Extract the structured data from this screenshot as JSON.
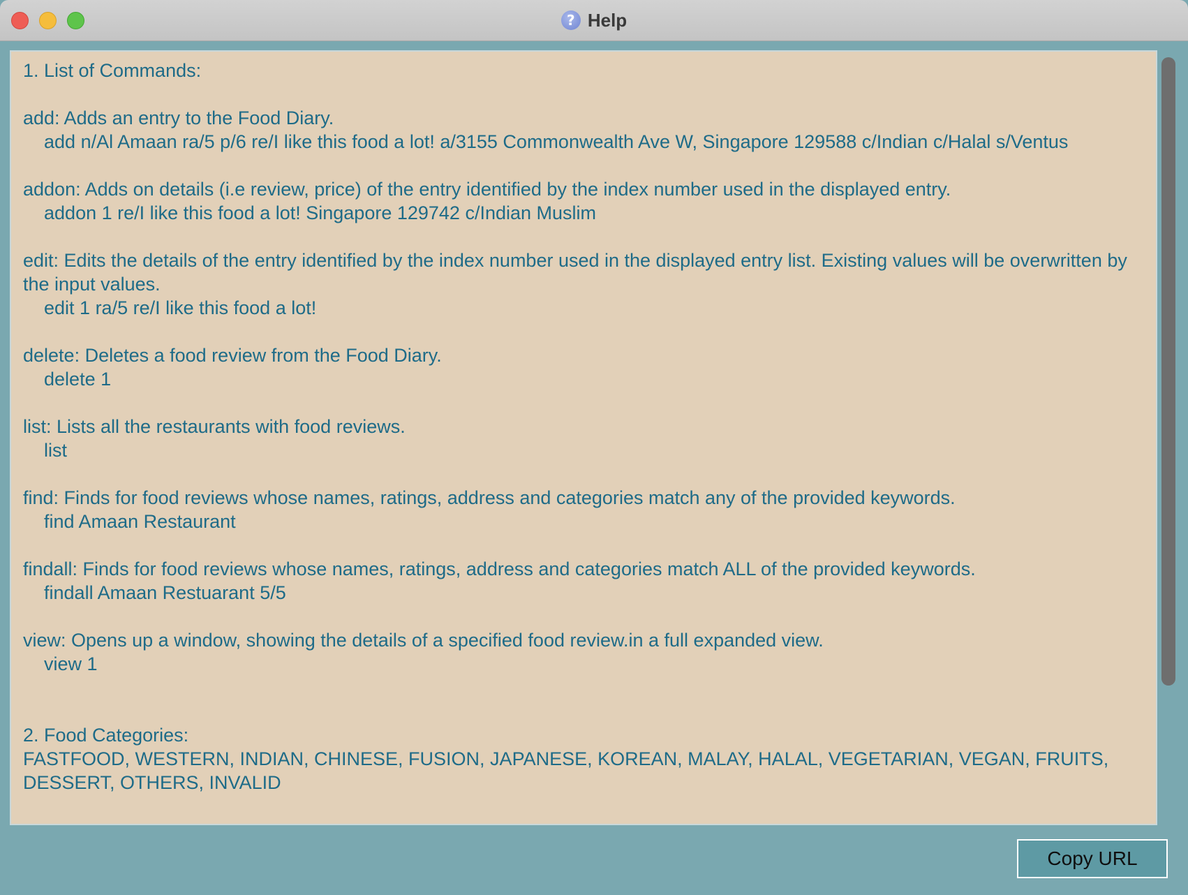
{
  "window": {
    "title": "Help",
    "title_icon": "help-question-icon"
  },
  "help": {
    "text": "1. List of Commands:\n\nadd: Adds an entry to the Food Diary.\n    add n/Al Amaan ra/5 p/6 re/I like this food a lot! a/3155 Commonwealth Ave W, Singapore 129588 c/Indian c/Halal s/Ventus\n\naddon: Adds on details (i.e review, price) of the entry identified by the index number used in the displayed entry.\n    addon 1 re/I like this food a lot! Singapore 129742 c/Indian Muslim\n\nedit: Edits the details of the entry identified by the index number used in the displayed entry list. Existing values will be overwritten by the input values.\n    edit 1 ra/5 re/I like this food a lot!\n\ndelete: Deletes a food review from the Food Diary.\n    delete 1\n\nlist: Lists all the restaurants with food reviews.\n    list\n\nfind: Finds for food reviews whose names, ratings, address and categories match any of the provided keywords.\n    find Amaan Restaurant\n\nfindall: Finds for food reviews whose names, ratings, address and categories match ALL of the provided keywords.\n    findall Amaan Restuarant 5/5\n\nview: Opens up a window, showing the details of a specified food review.in a full expanded view.\n    view 1\n\n\n2. Food Categories:\nFASTFOOD, WESTERN, INDIAN, CHINESE, FUSION, JAPANESE, KOREAN, MALAY, HALAL, VEGETARIAN, VEGAN, FRUITS, DESSERT, OTHERS, INVALID"
  },
  "footer": {
    "copy_url_label": "Copy URL"
  },
  "colors": {
    "background": "#7aa8b0",
    "content_background": "#e2d0b8",
    "text": "#1e6b88",
    "button": "#5e9aa4"
  }
}
